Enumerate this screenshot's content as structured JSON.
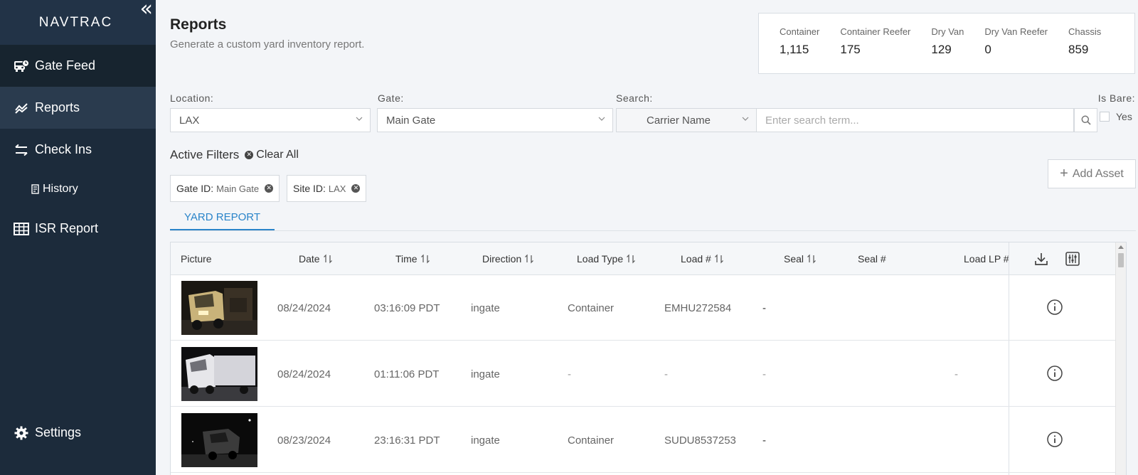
{
  "sidebar": {
    "brand": "NAVTRAC",
    "collapse_icon": "double-chevron-left-icon",
    "items": [
      {
        "label": "Gate Feed",
        "icon": "bus-icon"
      },
      {
        "label": "Reports",
        "icon": "chart-line-icon"
      },
      {
        "label": "Check Ins",
        "icon": "swap-arrows-icon"
      },
      {
        "label": "History",
        "icon": "receipt-icon"
      },
      {
        "label": "ISR Report",
        "icon": "table-grid-icon"
      }
    ],
    "settings": {
      "label": "Settings",
      "icon": "gear-icon"
    }
  },
  "header": {
    "title": "Reports",
    "subtitle": "Generate a custom yard inventory report."
  },
  "stats": [
    {
      "label": "Container",
      "value": "1,115"
    },
    {
      "label": "Container Reefer",
      "value": "175"
    },
    {
      "label": "Dry Van",
      "value": "129"
    },
    {
      "label": "Dry Van Reefer",
      "value": "0"
    },
    {
      "label": "Chassis",
      "value": "859"
    }
  ],
  "filters": {
    "location_label": "Location:",
    "location_value": "LAX",
    "gate_label": "Gate:",
    "gate_value": "Main Gate",
    "search_label": "Search:",
    "search_field": "Carrier Name",
    "search_placeholder": "Enter search term...",
    "isbare_label": "Is Bare:",
    "isbare_option": "Yes"
  },
  "active_filters": {
    "title": "Active Filters",
    "clear_all": "Clear All",
    "chips": [
      {
        "key": "Gate ID:",
        "value": "Main Gate"
      },
      {
        "key": "Site ID:",
        "value": "LAX"
      }
    ]
  },
  "add_asset_label": "Add Asset",
  "tab_label": "YARD REPORT",
  "table": {
    "columns": [
      "Picture",
      "Date",
      "Time",
      "Direction",
      "Load Type",
      "Load #",
      "Seal",
      "Seal #",
      "Load LP #"
    ],
    "tools": [
      "download-icon",
      "column-settings-icon"
    ],
    "rows": [
      {
        "date": "08/24/2024",
        "time": "03:16:09 PDT",
        "direction": "ingate",
        "load_type": "Container",
        "load_no": "EMHU272584",
        "seal": "-",
        "load_lp": ""
      },
      {
        "date": "08/24/2024",
        "time": "01:11:06 PDT",
        "direction": "ingate",
        "load_type": "-",
        "load_no": "-",
        "seal": "-",
        "load_lp": "-"
      },
      {
        "date": "08/23/2024",
        "time": "23:16:31 PDT",
        "direction": "ingate",
        "load_type": "Container",
        "load_no": "SUDU8537253",
        "seal": "-",
        "load_lp": ""
      }
    ]
  },
  "colors": {
    "sidebar_bg": "#1c2b3b",
    "accent": "#2a84c9"
  }
}
